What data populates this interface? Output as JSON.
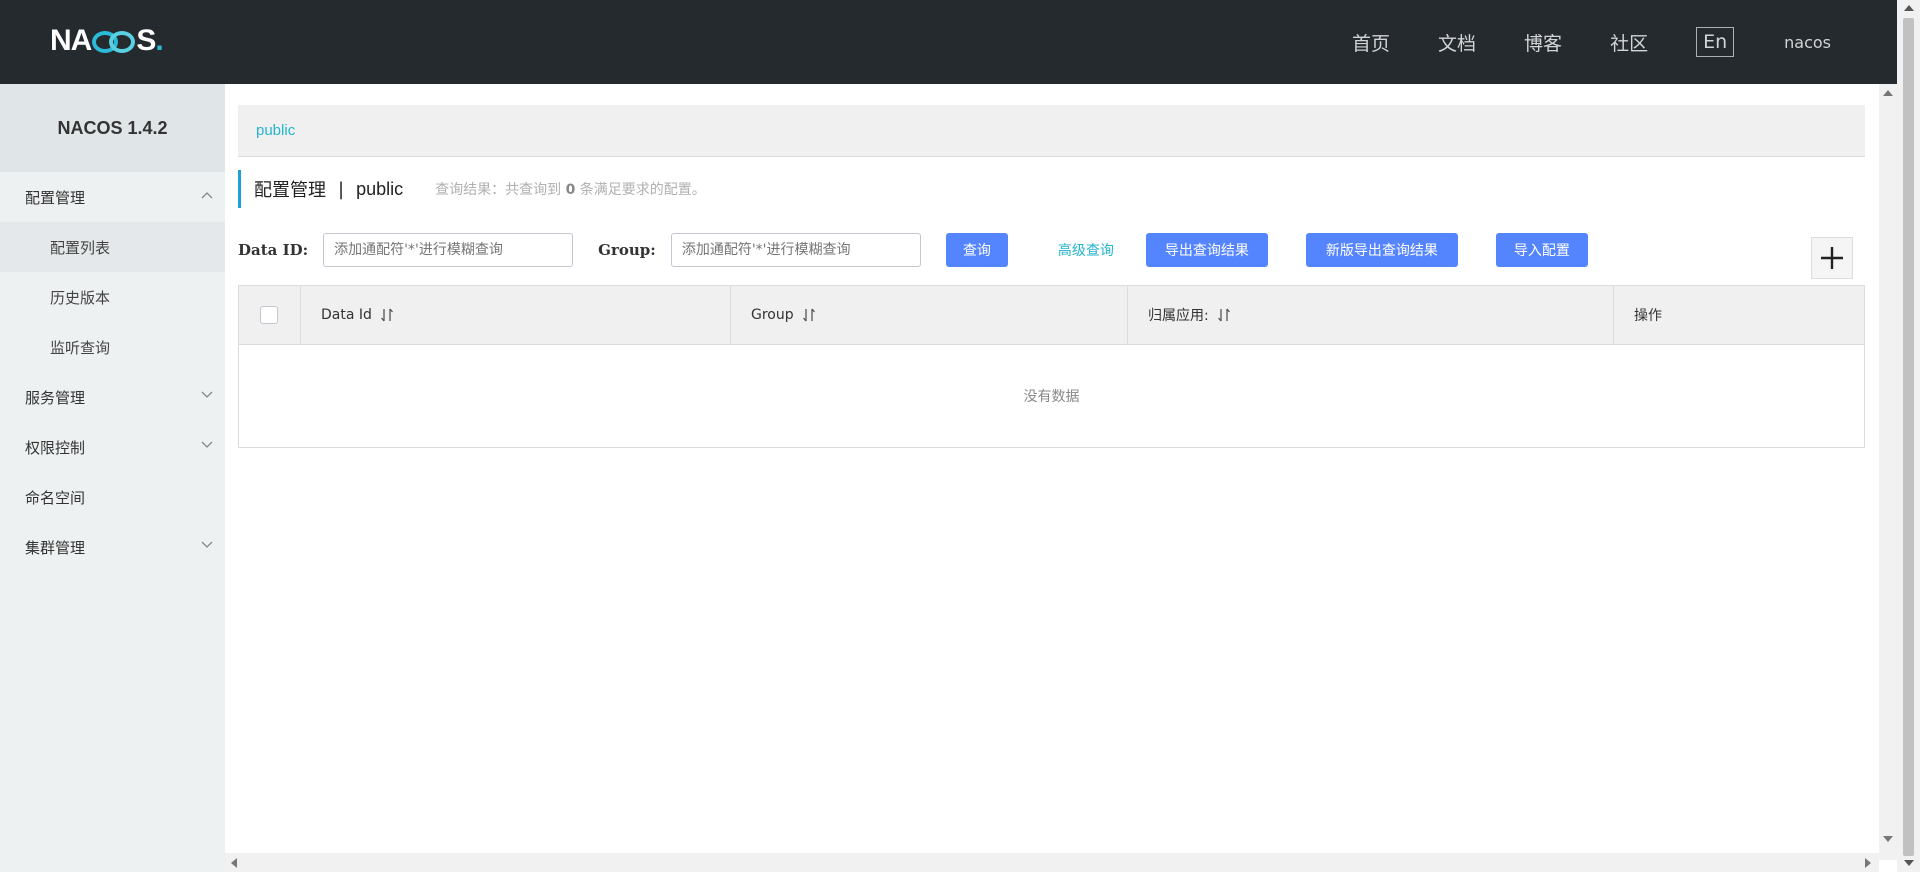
{
  "header": {
    "logo_text": "NACOS.",
    "nav": [
      "首页",
      "文档",
      "博客",
      "社区"
    ],
    "lang": "En",
    "user": "nacos"
  },
  "sidebar": {
    "version": "NACOS 1.4.2",
    "items": [
      {
        "label": "配置管理",
        "expanded": true
      },
      {
        "label": "配置列表",
        "sub": true,
        "active": true
      },
      {
        "label": "历史版本",
        "sub": true
      },
      {
        "label": "监听查询",
        "sub": true
      },
      {
        "label": "服务管理",
        "expanded": false
      },
      {
        "label": "权限控制",
        "expanded": false
      },
      {
        "label": "命名空间"
      },
      {
        "label": "集群管理",
        "expanded": false
      }
    ]
  },
  "breadcrumb": {
    "namespace": "public"
  },
  "page": {
    "title": "配置管理",
    "separator": "|",
    "namespace": "public",
    "summary_prefix": "查询结果：共查询到",
    "summary_count": "0",
    "summary_suffix": "条满足要求的配置。"
  },
  "filters": {
    "data_id_label": "Data ID:",
    "data_id_placeholder": "添加通配符'*'进行模糊查询",
    "group_label": "Group:",
    "group_placeholder": "添加通配符'*'进行模糊查询",
    "query_label": "查询",
    "advanced_label": "高级查询",
    "export_label": "导出查询结果",
    "export_new_label": "新版导出查询结果",
    "import_label": "导入配置"
  },
  "table": {
    "columns": [
      "Data Id",
      "Group",
      "归属应用:",
      "操作"
    ],
    "empty_text": "没有数据"
  },
  "colors": {
    "header_bg": "#252a2f",
    "accent": "#23b4cf",
    "button": "#5584ff",
    "sidebar_bg": "#eef1f2"
  }
}
